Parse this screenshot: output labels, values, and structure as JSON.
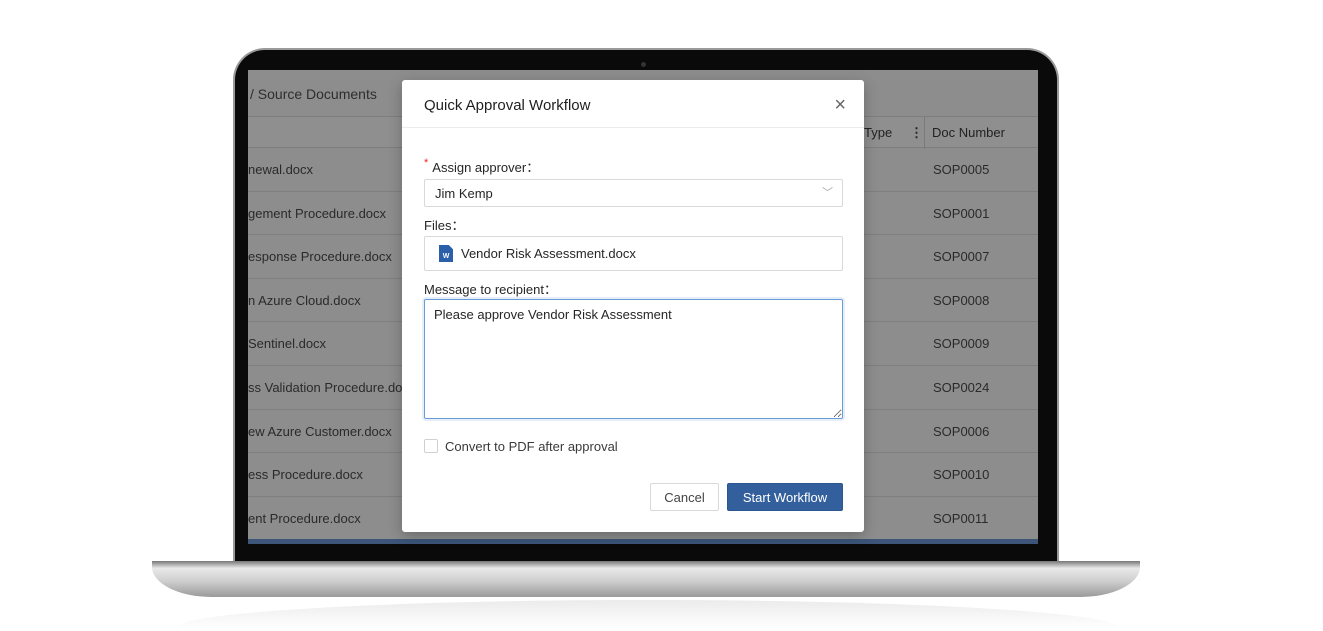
{
  "breadcrumb": "/ Source Documents",
  "table": {
    "headers": [
      "Type",
      "Doc Number"
    ],
    "rows": [
      {
        "name": "newal.docx",
        "doc": "SOP0005"
      },
      {
        "name": "gement Procedure.docx",
        "doc": "SOP0001"
      },
      {
        "name": "esponse Procedure.docx",
        "doc": "SOP0007"
      },
      {
        "name": "n Azure Cloud.docx",
        "doc": "SOP0008"
      },
      {
        "name": "Sentinel.docx",
        "doc": "SOP0009"
      },
      {
        "name": "ss Validation Procedure.docx",
        "doc": "SOP0024"
      },
      {
        "name": "ew Azure Customer.docx",
        "doc": "SOP0006"
      },
      {
        "name": "ess Procedure.docx",
        "doc": "SOP0010"
      },
      {
        "name": "ent Procedure.docx",
        "doc": "SOP0011"
      }
    ]
  },
  "modal": {
    "title": "Quick Approval Workflow",
    "close": "×",
    "approver_label": "Assign approver：",
    "required_mark": "*",
    "approver_value": "Jim Kemp",
    "files_label": "Files：",
    "file_name": "Vendor Risk Assessment.docx",
    "file_icon": "word-doc-icon",
    "message_label": "Message to recipient：",
    "message_value": "Please approve Vendor Risk Assessment",
    "convert_label": "Convert to PDF after approval",
    "convert_checked": false,
    "cancel": "Cancel",
    "start": "Start Workflow",
    "accent": "#33609c"
  }
}
